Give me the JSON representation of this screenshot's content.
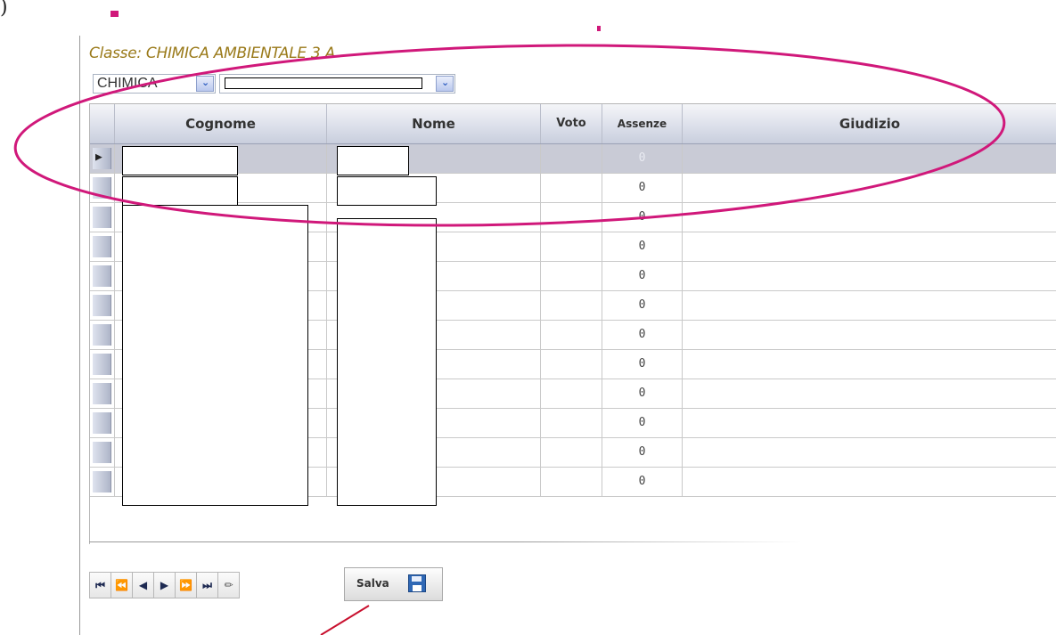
{
  "page": {
    "corner_text": ")"
  },
  "header": {
    "class_label": "Classe: CHIMICA AMBIENTALE 3 A"
  },
  "filters": {
    "subject_value": "CHIMICA",
    "period_value": ""
  },
  "grid": {
    "columns": [
      "Cognome",
      "Nome",
      "Voto",
      "Assenze",
      "Giudizio"
    ],
    "rows": [
      {
        "assenze": "0",
        "selected": true
      },
      {
        "assenze": "0"
      },
      {
        "assenze": "0"
      },
      {
        "assenze": "0"
      },
      {
        "assenze": "0"
      },
      {
        "assenze": "0"
      },
      {
        "assenze": "0"
      },
      {
        "assenze": "0"
      },
      {
        "assenze": "0"
      },
      {
        "assenze": "0"
      },
      {
        "assenze": "0"
      },
      {
        "assenze": "0"
      }
    ]
  },
  "toolbar": {
    "first_icon": "first-record-icon",
    "prev_page_icon": "previous-page-icon",
    "prev_icon": "previous-record-icon",
    "next_icon": "next-record-icon",
    "next_page_icon": "next-page-icon",
    "last_icon": "last-record-icon",
    "edit_icon": "pencil-icon",
    "save_label": "Salva",
    "save_icon": "floppy-disk-icon"
  },
  "colors": {
    "annotation": "#d0187a",
    "arrow": "#c8102e",
    "title": "#9a7a1a"
  }
}
